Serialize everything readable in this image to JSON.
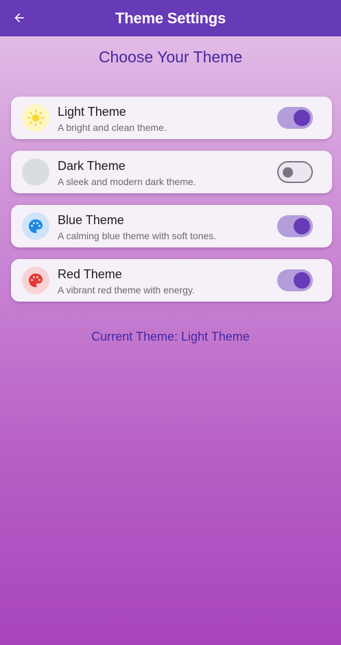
{
  "appbar": {
    "title": "Theme Settings"
  },
  "heading": "Choose Your Theme",
  "themes": [
    {
      "name": "Light Theme",
      "desc": "A bright and clean theme.",
      "enabled": true,
      "icon": "sun-icon",
      "icon_color": "#fdd835",
      "icon_bg": "#fff7c2"
    },
    {
      "name": "Dark Theme",
      "desc": "A sleek and modern dark theme.",
      "enabled": false,
      "icon": "moon-icon",
      "icon_color": "#546e7a",
      "icon_bg": "#d9dde2"
    },
    {
      "name": "Blue Theme",
      "desc": "A calming blue theme with soft tones.",
      "enabled": true,
      "icon": "palette-icon",
      "icon_color": "#1e88e5",
      "icon_bg": "#cfe3fb"
    },
    {
      "name": "Red Theme",
      "desc": "A vibrant red theme with energy.",
      "enabled": true,
      "icon": "palette-icon",
      "icon_color": "#e53935",
      "icon_bg": "#f8d3d6"
    }
  ],
  "current_theme": "Current Theme: Light Theme",
  "colors": {
    "appbar": "#673ab7",
    "accent_text": "#4527a0",
    "switch_on_track": "#b39ddb",
    "switch_on_knob": "#673ab7"
  }
}
